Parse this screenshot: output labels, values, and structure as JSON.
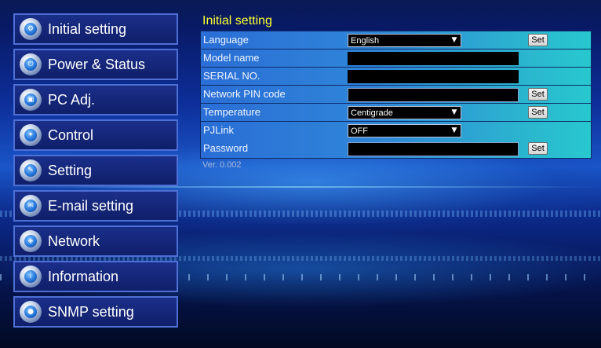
{
  "sidebar": {
    "items": [
      {
        "label": "Initial setting",
        "icon": "initial-setting-icon"
      },
      {
        "label": "Power & Status",
        "icon": "power-status-icon"
      },
      {
        "label": "PC Adj.",
        "icon": "pc-adj-icon"
      },
      {
        "label": "Control",
        "icon": "control-icon"
      },
      {
        "label": "Setting",
        "icon": "setting-icon"
      },
      {
        "label": "E-mail setting",
        "icon": "email-icon"
      },
      {
        "label": "Network",
        "icon": "network-icon"
      },
      {
        "label": "Information",
        "icon": "information-icon"
      },
      {
        "label": "SNMP setting",
        "icon": "snmp-icon"
      }
    ]
  },
  "main": {
    "title": "Initial setting",
    "rows": {
      "language": {
        "label": "Language",
        "value": "English",
        "set": "Set"
      },
      "model_name": {
        "label": "Model name",
        "value": ""
      },
      "serial_no": {
        "label": "SERIAL NO.",
        "value": ""
      },
      "network_pin": {
        "label": "Network PIN code",
        "value": "",
        "set": "Set"
      },
      "temperature": {
        "label": "Temperature",
        "value": "Centigrade",
        "set": "Set"
      },
      "pjlink": {
        "label": "PJLink",
        "value": "OFF"
      },
      "password": {
        "label": "Password",
        "value": "",
        "set": "Set"
      }
    },
    "version": "Ver. 0.002"
  },
  "colors": {
    "title": "#ffff33",
    "table_left": "#2a6ed6",
    "table_right": "#27c8cf",
    "nav_border": "#4d6fd6"
  }
}
